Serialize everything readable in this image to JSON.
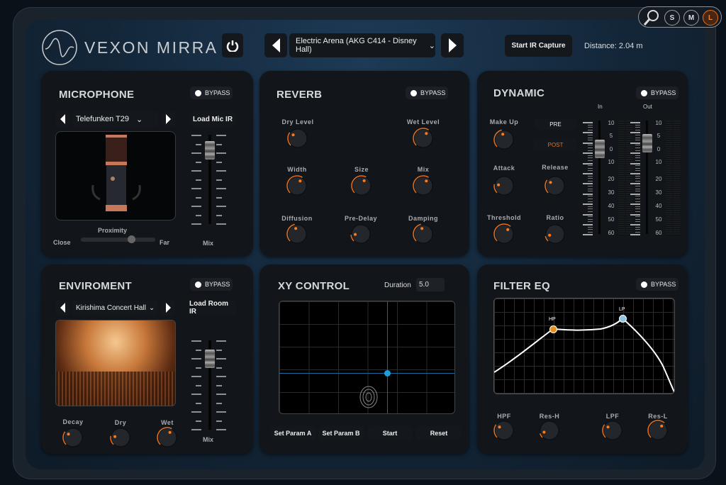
{
  "header": {
    "title": "VEXON MIRRA",
    "preset": "Electric Arena (AKG C414 - Disney Hall)",
    "start_ir": "Start IR Capture",
    "distance": "Distance: 2.04 m"
  },
  "size_buttons": {
    "s": "S",
    "m": "M",
    "l": "L",
    "active": "L"
  },
  "colors": {
    "accent": "#e8701a",
    "lp_point": "#8ec4e8",
    "xy_cursor": "#1aa0e0"
  },
  "microphone": {
    "title": "MICROPHONE",
    "bypass": "BYPASS",
    "model": "Telefunken T29",
    "load": "Load Mic IR",
    "proximity": "Proximity",
    "close": "Close",
    "far": "Far",
    "proximity_value": 0.68,
    "mix": "Mix",
    "mix_value": 0.92
  },
  "environment": {
    "title": "ENVIROMENT",
    "bypass": "BYPASS",
    "room": "Kirishima Concert Hall",
    "load": "Load Room IR",
    "mix": "Mix",
    "mix_value": 0.88,
    "knobs": {
      "decay": {
        "label": "Decay",
        "value": 0.3
      },
      "dry": {
        "label": "Dry",
        "value": 0.2
      },
      "wet": {
        "label": "Wet",
        "value": 0.6
      }
    }
  },
  "reverb": {
    "title": "REVERB",
    "bypass": "BYPASS",
    "knobs": {
      "dry_level": {
        "label": "Dry Level",
        "value": 0.3
      },
      "wet_level": {
        "label": "Wet Level",
        "value": 0.62
      },
      "width": {
        "label": "Width",
        "value": 0.62
      },
      "size": {
        "label": "Size",
        "value": 0.6
      },
      "mix": {
        "label": "Mix",
        "value": 0.62
      },
      "diffusion": {
        "label": "Diffusion",
        "value": 0.45
      },
      "pre_delay": {
        "label": "Pre-Delay",
        "value": 0.15
      },
      "damping": {
        "label": "Damping",
        "value": 0.45
      }
    }
  },
  "dynamic": {
    "title": "DYNAMIC",
    "bypass": "BYPASS",
    "pre": "PRE",
    "post": "POST",
    "in": "In",
    "out": "Out",
    "scale": [
      "10",
      "5",
      "0",
      "10",
      "20",
      "30",
      "40",
      "50",
      "60"
    ],
    "in_value": 0.82,
    "out_value": 0.87,
    "knobs": {
      "make_up": {
        "label": "Make Up",
        "value": 0.45
      },
      "attack": {
        "label": "Attack",
        "value": 0.2
      },
      "release": {
        "label": "Release",
        "value": 0.3
      },
      "threshold": {
        "label": "Threshold",
        "value": 0.65
      },
      "ratio": {
        "label": "Ratio",
        "value": 0.12
      }
    }
  },
  "xy": {
    "title": "XY CONTROL",
    "duration_label": "Duration",
    "duration": "5.0",
    "set_a": "Set Param A",
    "set_b": "Set Param B",
    "start": "Start",
    "reset": "Reset"
  },
  "filter": {
    "title": "FILTER EQ",
    "bypass": "BYPASS",
    "hp": "HP",
    "lp": "LP",
    "knobs": {
      "hpf": {
        "label": "HPF",
        "value": 0.3
      },
      "res_h": {
        "label": "Res-H",
        "value": 0.1
      },
      "lpf": {
        "label": "LPF",
        "value": 0.3
      },
      "res_l": {
        "label": "Res-L",
        "value": 0.65
      }
    }
  }
}
